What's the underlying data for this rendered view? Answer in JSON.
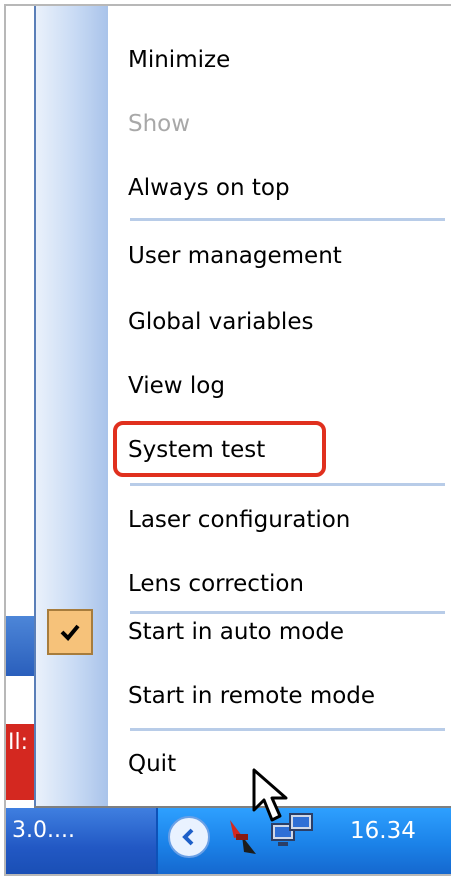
{
  "menu": {
    "items": [
      {
        "label": "Minimize",
        "enabled": true
      },
      {
        "label": "Show",
        "enabled": false
      },
      {
        "label": "Always on top",
        "enabled": true
      },
      {
        "label": "User management",
        "enabled": true
      },
      {
        "label": "Global variables",
        "enabled": true
      },
      {
        "label": "View log",
        "enabled": true
      },
      {
        "label": "System test",
        "enabled": true,
        "highlighted": true
      },
      {
        "label": "Laser configuration",
        "enabled": true
      },
      {
        "label": "Lens correction",
        "enabled": true
      },
      {
        "label": "Start in auto mode",
        "enabled": true,
        "checked": true
      },
      {
        "label": "Start in remote mode",
        "enabled": true
      },
      {
        "label": "Quit",
        "enabled": true
      }
    ]
  },
  "taskbar": {
    "left_text": "3.0....",
    "clock": "16.34"
  },
  "background": {
    "red_fragment_text": "Il:"
  },
  "colors": {
    "highlight_ring": "#e0301e",
    "checkbox_fill": "#f6c27a",
    "taskbar": "#2258c4",
    "tray": "#1b82e8"
  },
  "icons": {
    "check": "checkmark-icon",
    "tray_chevron": "chevron-left-icon",
    "tray_app": "app-tray-icon",
    "tray_network": "network-computers-icon",
    "cursor": "mouse-pointer-icon"
  }
}
